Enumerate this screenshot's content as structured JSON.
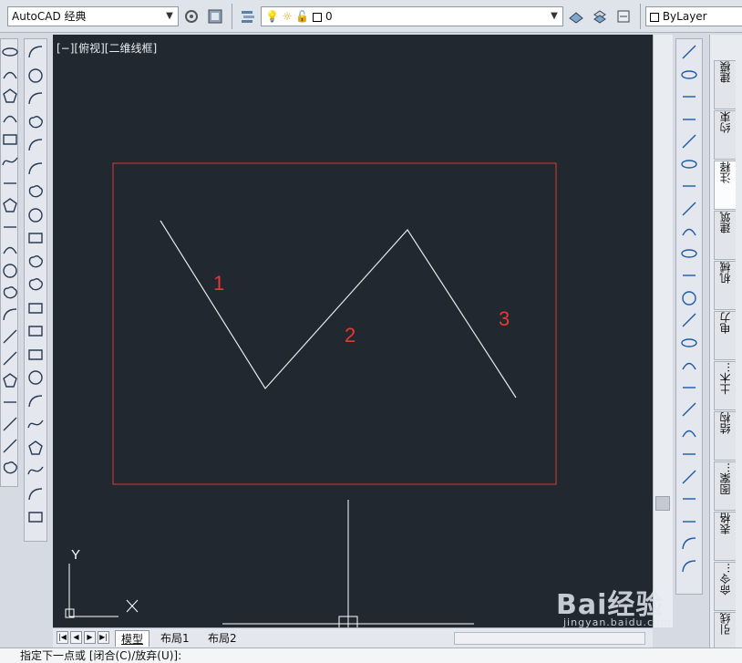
{
  "workspace": {
    "label": "AutoCAD 经典"
  },
  "layer": {
    "current": "0"
  },
  "properties": {
    "color": "ByLayer"
  },
  "view": {
    "label": "[−][俯视][二维线框]"
  },
  "drawing": {
    "rectangle_color": "#d23b33",
    "line_color": "#e8e8e8",
    "annotations": [
      "1",
      "2",
      "3"
    ],
    "annotation_color": "#e23b30",
    "ucs": {
      "x_label": "X",
      "y_label": "Y"
    }
  },
  "layout_tabs": [
    "模型",
    "布局1",
    "布局2"
  ],
  "active_tab": "模型",
  "palette_tabs": [
    "建模",
    "约束",
    "注释",
    "建筑",
    "机械",
    "电力",
    "土木...",
    "结构",
    "图案...",
    "表格",
    "命令...",
    "引线"
  ],
  "active_palette_tab": "注释",
  "command_line": "指定下一点或 [闭合(C)/放弃(U)]:",
  "watermark": {
    "logo": "Bai经验",
    "url": "jingyan.baidu.com"
  },
  "left_tools_col1": [
    "line-icon",
    "construction-line-icon",
    "polyline-icon",
    "polygon-icon",
    "rectangle-icon",
    "arc-icon",
    "circle-icon",
    "revcloud-icon",
    "spline-icon",
    "ellipse-icon",
    "ellipse-arc-icon",
    "insert-block-icon",
    "make-block-icon",
    "point-icon",
    "hatch-icon",
    "gradient-icon",
    "region-icon",
    "table-icon",
    "mtext-icon",
    "add-selected-icon"
  ],
  "left_tools_col2": [
    "linear-dim-icon",
    "aligned-dim-icon",
    "arc-length-icon",
    "ordinate-dim-icon",
    "radius-dim-icon",
    "jogged-dim-icon",
    "diameter-dim-icon",
    "angular-dim-icon",
    "quick-dim-icon",
    "baseline-dim-icon",
    "continue-dim-icon",
    "dim-space-icon",
    "dim-break-icon",
    "tolerance-icon",
    "center-mark-icon",
    "inspection-icon",
    "jogged-linear-icon",
    "dim-edit-icon",
    "dim-text-edit-icon",
    "dim-update-icon",
    "dim-style-icon"
  ],
  "right_tools": [
    "erase-icon",
    "copy-icon",
    "mirror-icon",
    "offset-icon",
    "array-icon",
    "move-icon",
    "rotate-icon",
    "scale-icon",
    "stretch-icon",
    "trim-icon",
    "extend-icon",
    "break-point-icon",
    "break-icon",
    "join-icon",
    "chamfer-icon",
    "fillet-icon",
    "blend-icon",
    "explode-icon",
    "draw-order-front-icon",
    "draw-order-back-icon",
    "draw-order-above-icon",
    "draw-order-under-icon",
    "text-front-icon",
    "hatch-back-icon"
  ]
}
